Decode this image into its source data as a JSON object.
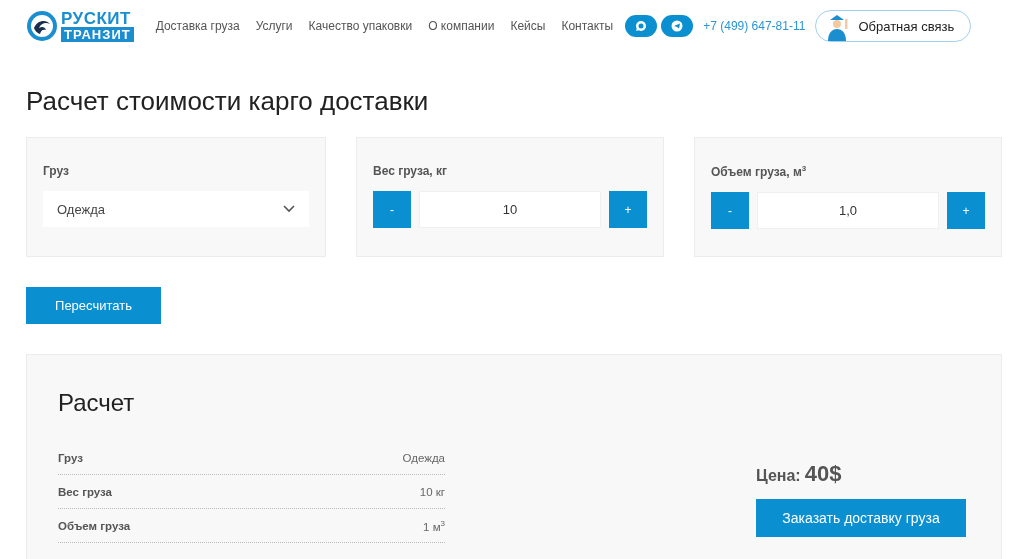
{
  "header": {
    "logo": {
      "line_1": "РУСКИТ",
      "line_2": "ТРАНЗИТ"
    },
    "nav": [
      "Доставка груза",
      "Услуги",
      "Качество упаковки",
      "О компании",
      "Кейсы",
      "Контакты"
    ],
    "phone": "+7 (499) 647-81-11",
    "feedback_button": "Обратная связь"
  },
  "title": "Расчет стоимости карго доставки",
  "fields": [
    {
      "kind": "select",
      "label": "Груз",
      "value": "Одежда"
    },
    {
      "kind": "stepper",
      "label": "Вес груза, кг",
      "minus": "-",
      "value": "10",
      "plus": "+"
    },
    {
      "kind": "stepper",
      "label": "Объем груза, м$^{3}$",
      "minus": "-",
      "value": "1,0",
      "plus": "+"
    }
  ],
  "recalculate_button": "Пересчитать",
  "result": {
    "title": "Расчет",
    "rows": [
      {
        "label": "Груз",
        "value": "Одежда"
      },
      {
        "label": "Вес груза",
        "value": "10 кг"
      },
      {
        "label": "Объем груза",
        "value": "1 м$^{3}$"
      }
    ],
    "price_label": "Цена:",
    "price": "40$",
    "order_button": "Заказать доставку груза"
  }
}
